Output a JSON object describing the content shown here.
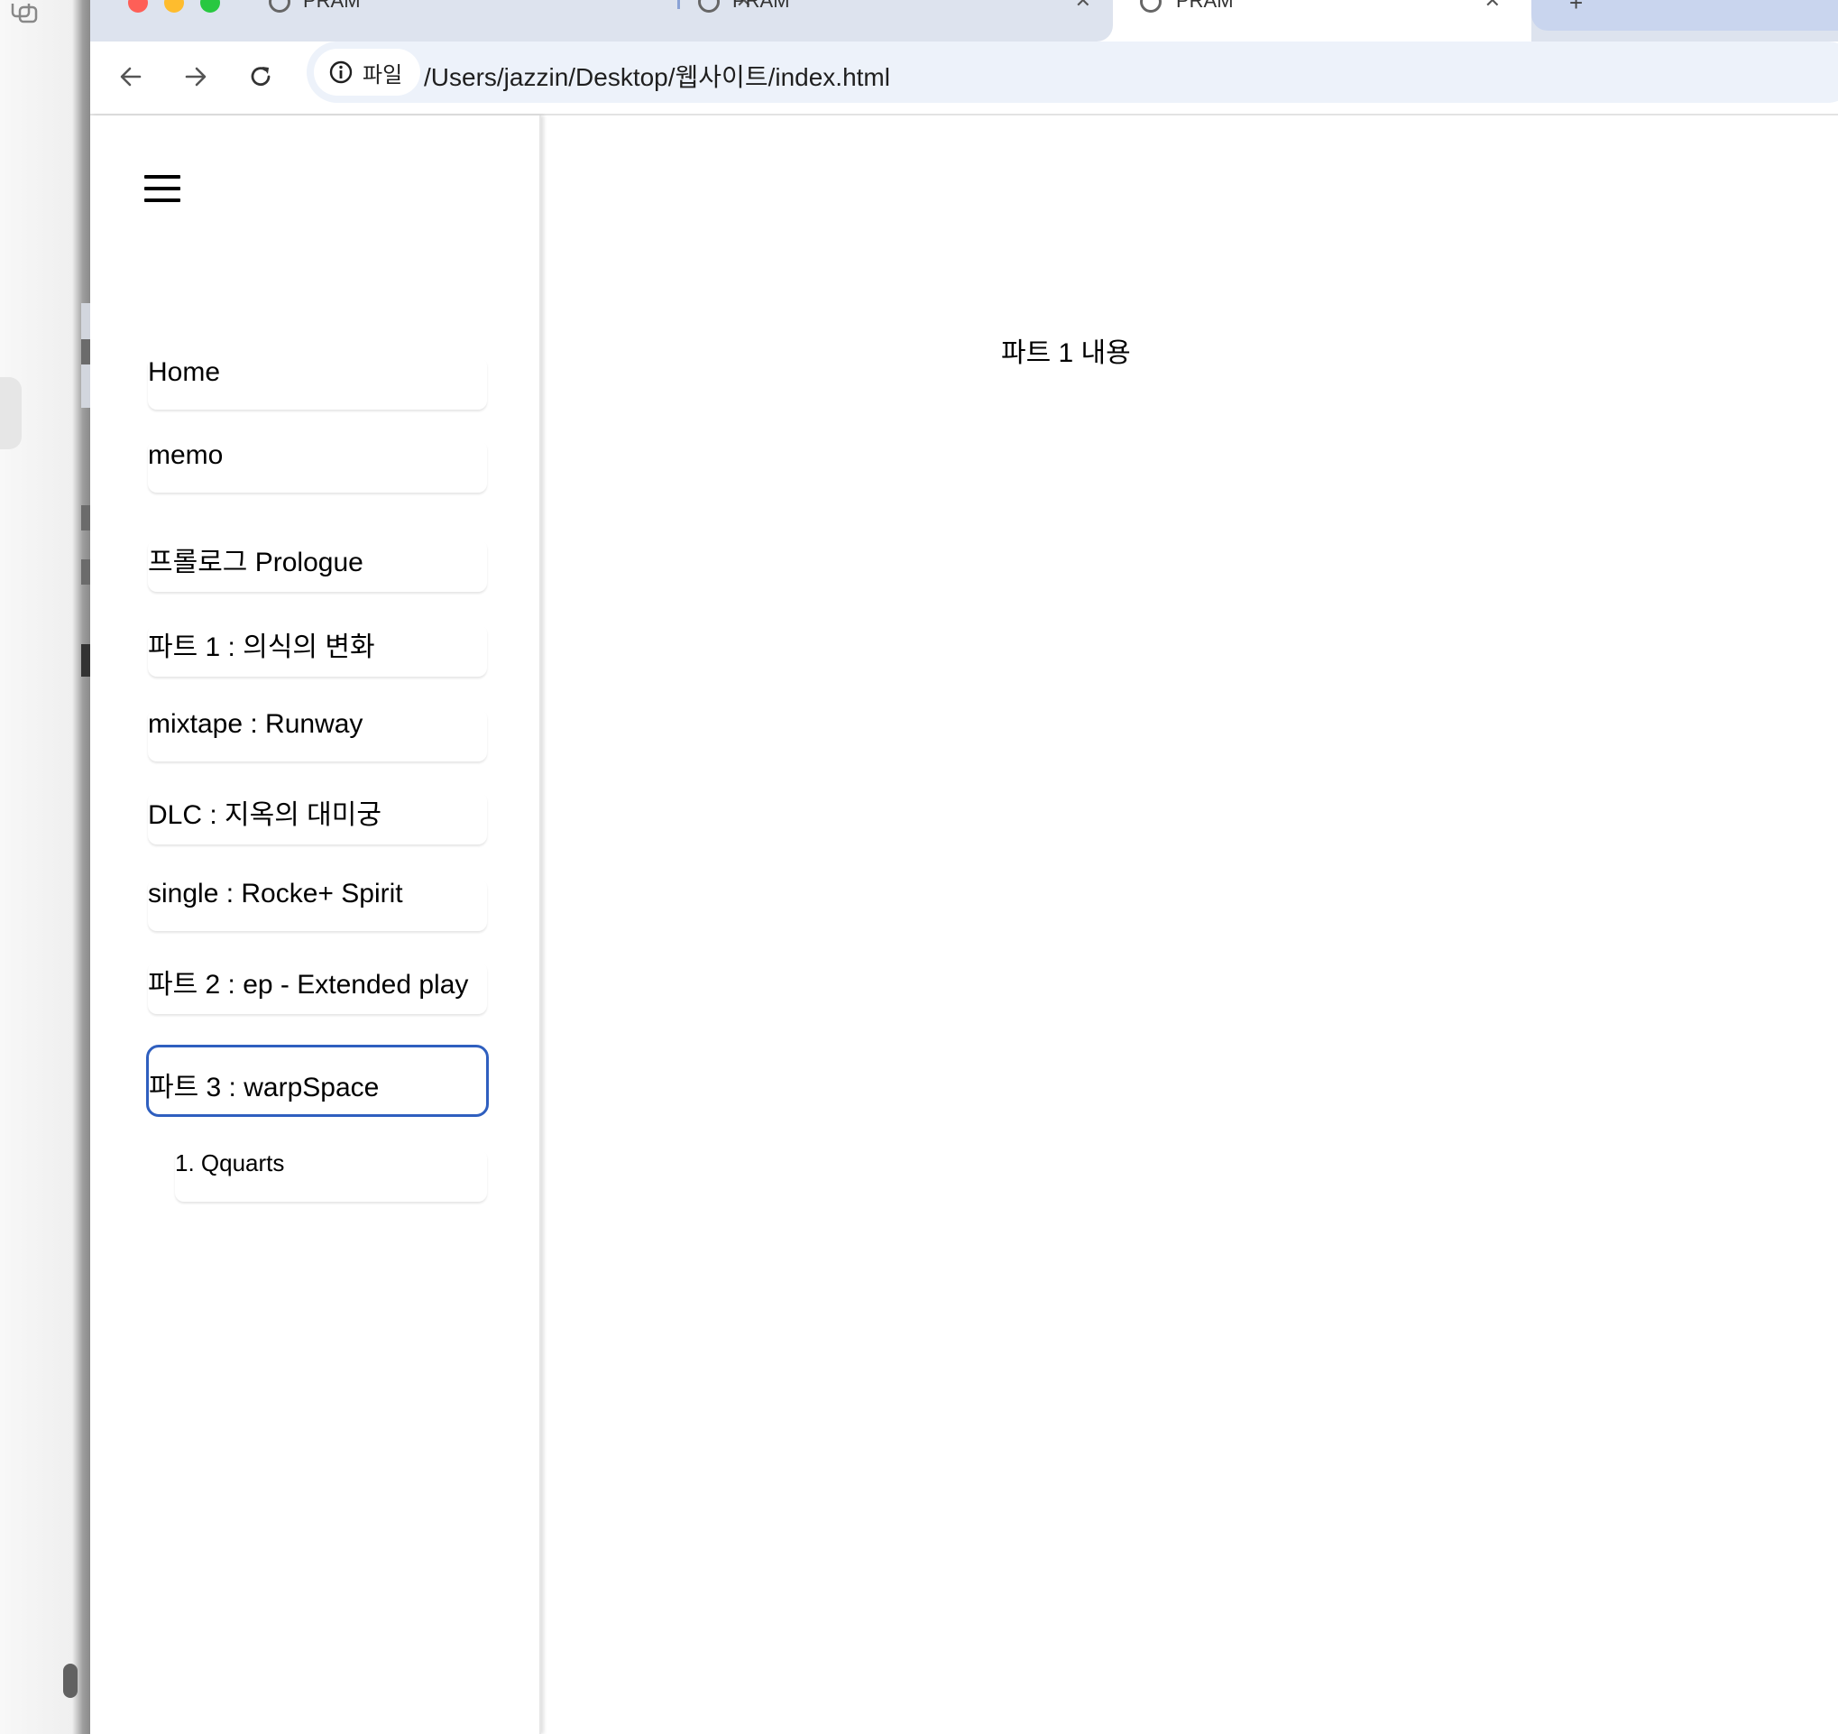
{
  "browser": {
    "tabs": [
      {
        "title": "PRAM"
      },
      {
        "title": "PRAM"
      },
      {
        "title": "PRAM",
        "active": true
      }
    ],
    "address_chip_label": "파일",
    "url": "/Users/jazzin/Desktop/웹사이트/index.html"
  },
  "sidebar": {
    "items": [
      {
        "label": "Home"
      },
      {
        "label": "memo"
      },
      {
        "label": "프롤로그 Prologue"
      },
      {
        "label": "파트 1 : 의식의 변화"
      },
      {
        "label": "mixtape : Runway"
      },
      {
        "label": "DLC : 지옥의 대미궁"
      },
      {
        "label": "single : Rocke+ Spirit"
      },
      {
        "label": "파트 2 : ep - Extended play"
      },
      {
        "label": "파트 3 : warpSpace",
        "selected": true
      }
    ],
    "sub_items": [
      {
        "label": "1. Qquarts"
      }
    ]
  },
  "main": {
    "content": "파트 1 내용"
  },
  "colors": {
    "selected_border": "#2f5fbf",
    "tabstrip": "#dde3ee",
    "omnibox": "#edf2fa"
  }
}
